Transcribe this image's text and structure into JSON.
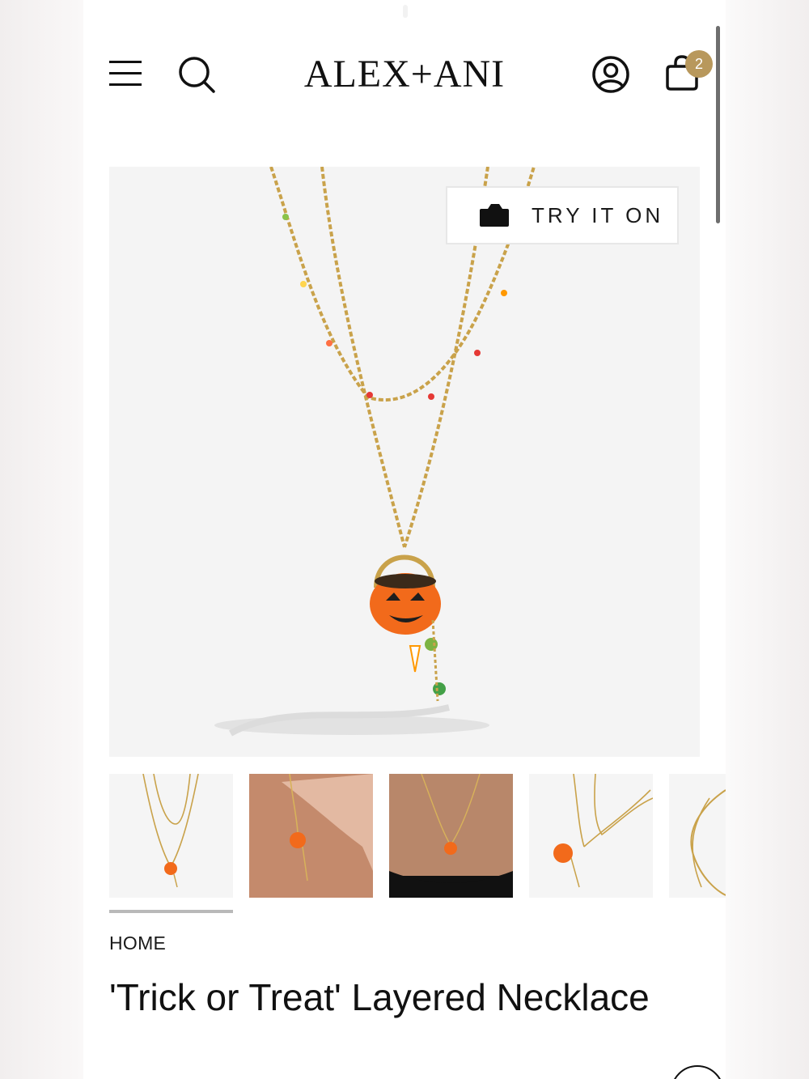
{
  "header": {
    "logo_text": "ALEX+ANI",
    "menu_icon": "hamburger-menu-icon",
    "search_icon": "search-icon",
    "account_icon": "user-account-icon",
    "cart_icon": "shopping-bag-icon",
    "cart_count": "2",
    "badge_color": "#b8985c"
  },
  "hero": {
    "try_on_label": "TRY IT ON",
    "try_on_icon": "camera-icon",
    "image_subject": "pumpkin-necklace-photo"
  },
  "thumbnails": [
    {
      "name": "thumbnail-necklace-flat"
    },
    {
      "name": "thumbnail-necklace-hand"
    },
    {
      "name": "thumbnail-necklace-worn"
    },
    {
      "name": "thumbnail-necklace-closeup"
    },
    {
      "name": "thumbnail-chain-detail"
    }
  ],
  "thumbnail_progress": 0.2,
  "breadcrumb": {
    "label": "HOME"
  },
  "product": {
    "title": "'Trick or Treat' Layered Necklace"
  }
}
